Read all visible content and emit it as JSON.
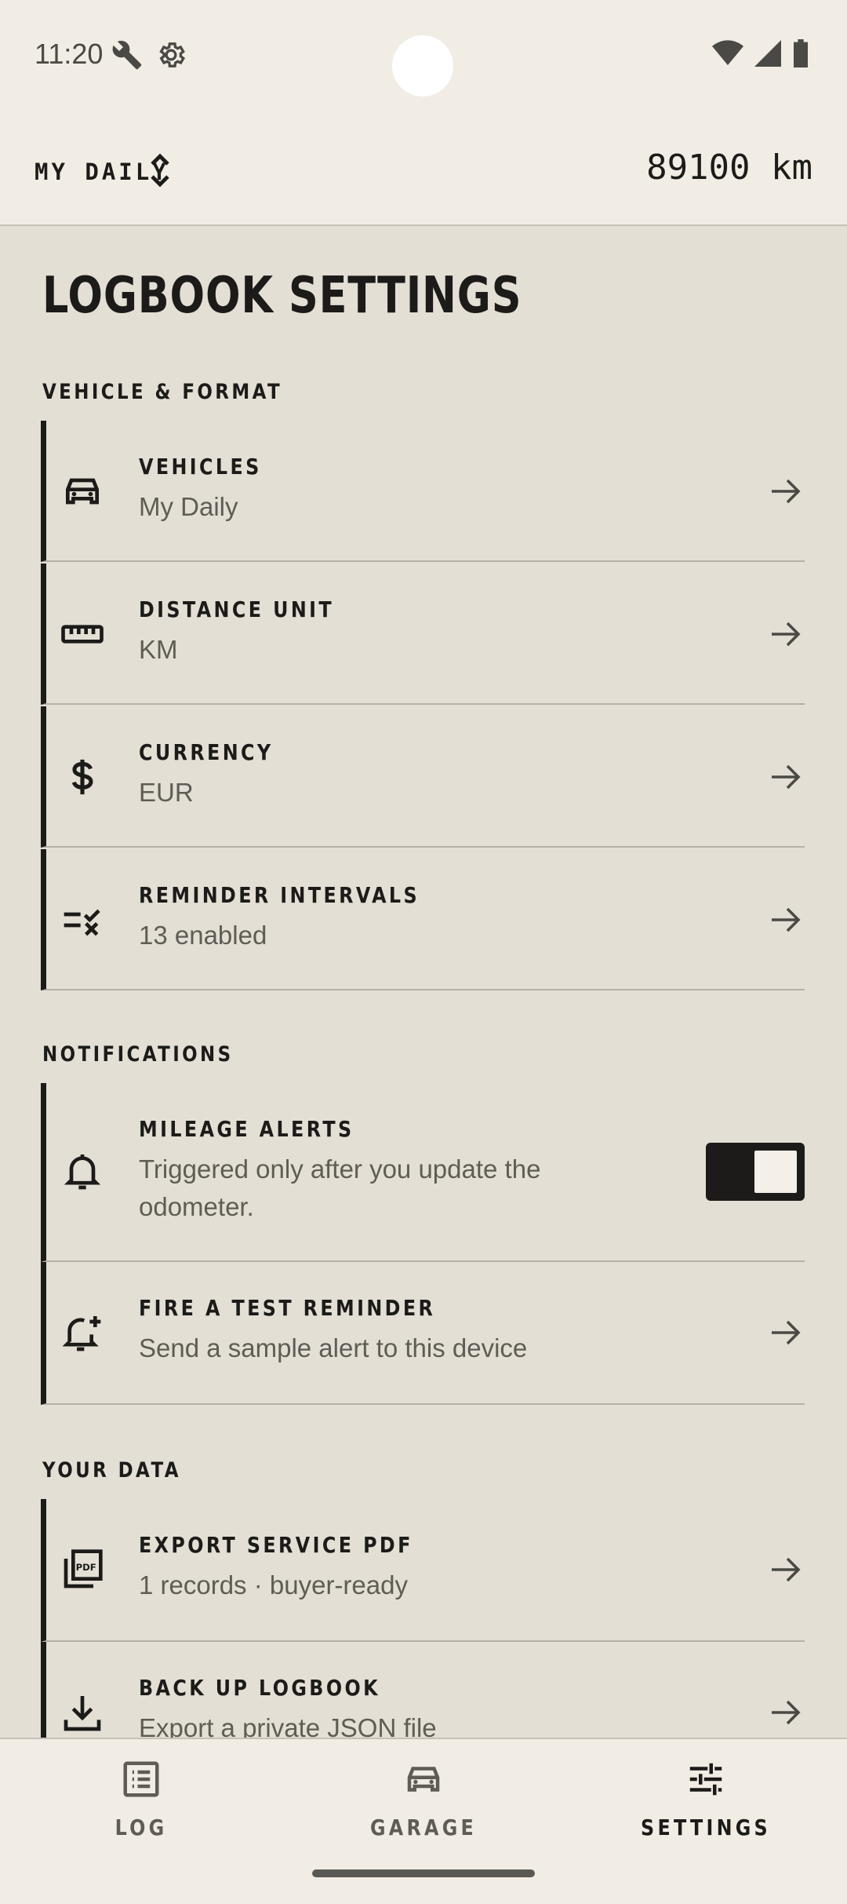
{
  "status_bar": {
    "time": "11:20"
  },
  "vehicle_bar": {
    "vehicle_name": "MY DAILY",
    "odometer": "89100 km"
  },
  "page_title": "LOGBOOK SETTINGS",
  "sections": {
    "vehicle_format": {
      "label": "VEHICLE & FORMAT",
      "rows": [
        {
          "title": "VEHICLES",
          "subtitle": "My Daily"
        },
        {
          "title": "DISTANCE UNIT",
          "subtitle": "KM"
        },
        {
          "title": "CURRENCY",
          "subtitle": "EUR"
        },
        {
          "title": "REMINDER INTERVALS",
          "subtitle": "13 enabled"
        }
      ]
    },
    "notifications": {
      "label": "NOTIFICATIONS",
      "rows": [
        {
          "title": "MILEAGE ALERTS",
          "subtitle": "Triggered only after you update the odometer.",
          "toggle_on": true
        },
        {
          "title": "FIRE A TEST REMINDER",
          "subtitle": "Send a sample alert to this device"
        }
      ]
    },
    "your_data": {
      "label": "YOUR DATA",
      "rows": [
        {
          "title": "EXPORT SERVICE PDF",
          "subtitle": "1 records · buyer-ready"
        },
        {
          "title": "BACK UP LOGBOOK",
          "subtitle": "Export a private JSON file"
        }
      ]
    }
  },
  "bottom_nav": {
    "items": [
      {
        "label": "LOG",
        "icon": "list-icon"
      },
      {
        "label": "GARAGE",
        "icon": "car-icon"
      },
      {
        "label": "SETTINGS",
        "icon": "sliders-icon",
        "active": true
      }
    ]
  },
  "colors": {
    "background": "#f1ede5",
    "content": "#e3dfd5",
    "ink": "#1c1b19",
    "muted": "#5f5c55"
  }
}
